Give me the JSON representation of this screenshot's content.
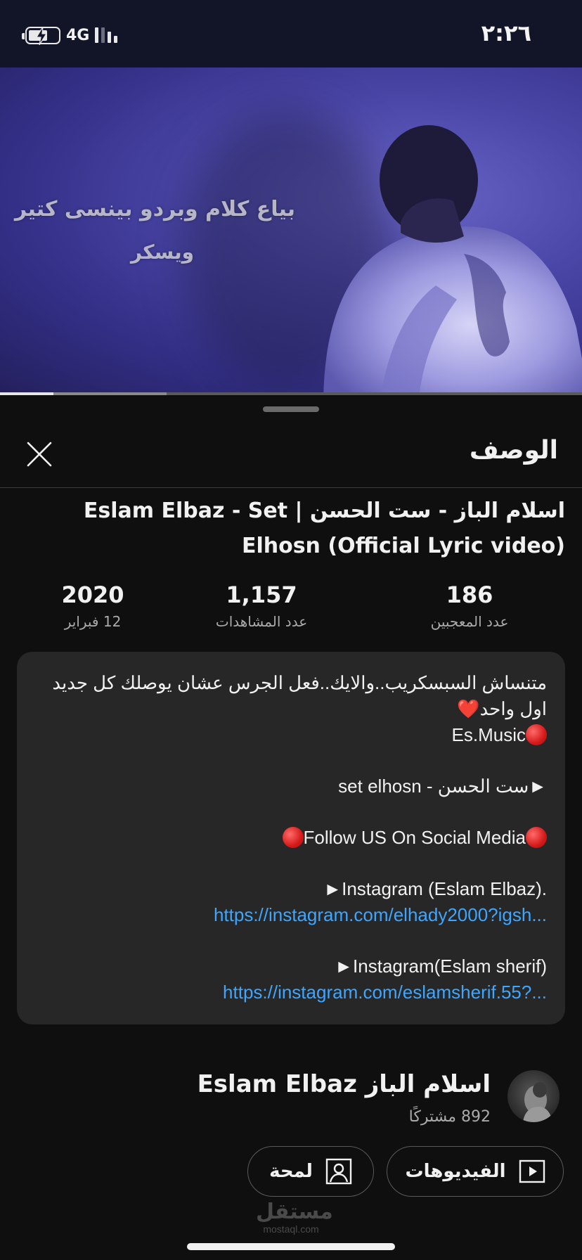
{
  "status_bar": {
    "time": "٢:٢٦",
    "network": "4G"
  },
  "player": {
    "overlay_line1": "بياع كلام وبردو بينسى كتير",
    "overlay_line2": "ويسكر",
    "progress_played": 0.092,
    "progress_buffered": 0.286
  },
  "sheet": {
    "title": "الوصف"
  },
  "video": {
    "title": "اسلام الباز - ست الحسن | Eslam Elbaz - Set Elhosn (Official Lyric video)"
  },
  "stats": {
    "likes_value": "186",
    "likes_label": "عدد المعجبين",
    "views_value": "1,157",
    "views_label": "عدد المشاهدات",
    "year_value": "2020",
    "date_label": "12 فبراير"
  },
  "description": {
    "line1": "متنساش السبسكريب..والايك..فعل الجرس عشان يوصلك كل جديد اول واحد",
    "brand": "Es.Music",
    "track": "►ست الحسن - set elhosn",
    "follow": "Follow US On Social Media",
    "ig1_label": "►Instagram (Eslam Elbaz).",
    "ig1_link": "https://instagram.com/elhady2000?igsh...",
    "ig2_label": "►Instagram(Eslam sherif)",
    "ig2_link": "https://instagram.com/eslamsherif.55?..."
  },
  "channel": {
    "name": "اسلام الباز Eslam Elbaz",
    "subscribers": "892 مشتركًا",
    "videos_button": "الفيديوهات",
    "about_button": "لمحة"
  },
  "watermark": {
    "arabic": "مستقل",
    "latin": "mostaql.com"
  },
  "colors": {
    "link": "#3ea6ff",
    "background": "#0f0f0f",
    "card": "#272727",
    "video_tint": "#4b47a8"
  }
}
